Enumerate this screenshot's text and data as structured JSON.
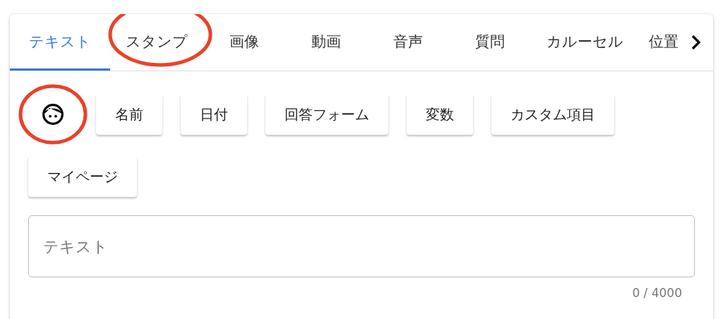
{
  "tabs": [
    {
      "label": "テキスト",
      "selected": true,
      "circled": false
    },
    {
      "label": "スタンプ",
      "selected": false,
      "circled": true
    },
    {
      "label": "画像",
      "selected": false,
      "circled": false
    },
    {
      "label": "動画",
      "selected": false,
      "circled": false
    },
    {
      "label": "音声",
      "selected": false,
      "circled": false
    },
    {
      "label": "質問",
      "selected": false,
      "circled": false
    },
    {
      "label": "カルーセル",
      "selected": false,
      "circled": false
    },
    {
      "label": "位置",
      "selected": false,
      "circled": false
    }
  ],
  "face_icon": {
    "circled": true
  },
  "insert_buttons": [
    "名前",
    "日付",
    "回答フォーム",
    "変数",
    "カスタム項目",
    "マイページ"
  ],
  "message": {
    "placeholder": "テキスト",
    "counter": "0 / 4000"
  }
}
